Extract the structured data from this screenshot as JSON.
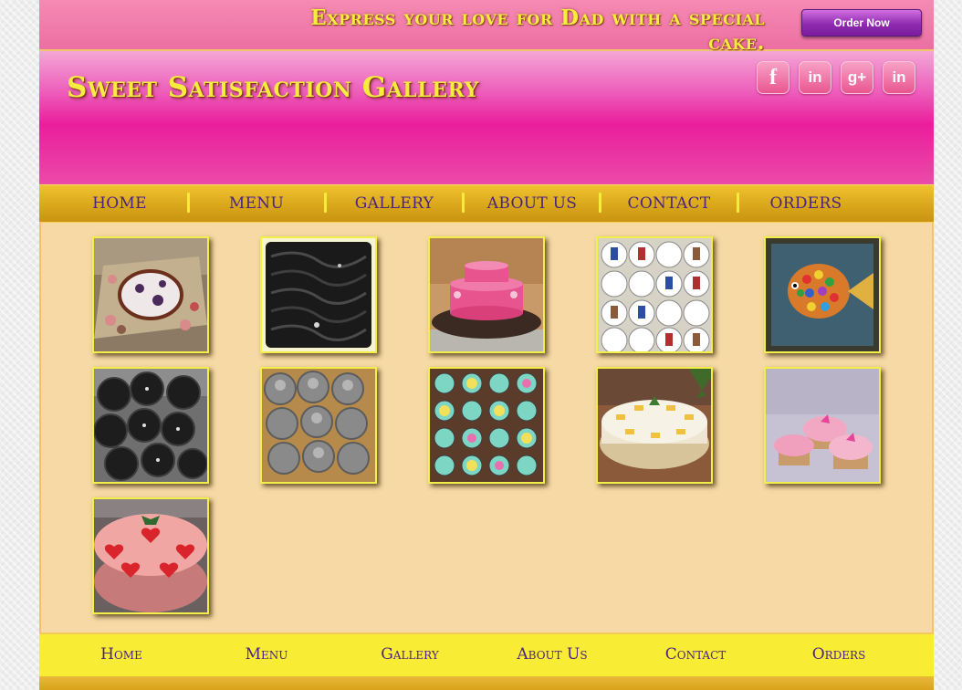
{
  "promo": {
    "text": "Express your love for Dad with a special cake.",
    "order_button": "Order Now"
  },
  "header": {
    "site_title": "Sweet Satisfaction Gallery",
    "socials": [
      {
        "icon": "facebook-icon",
        "glyph": "f"
      },
      {
        "icon": "linkedin-icon",
        "glyph": "in"
      },
      {
        "icon": "google-plus-icon",
        "glyph": "g+"
      },
      {
        "icon": "linkedin-icon",
        "glyph": "in"
      }
    ]
  },
  "nav": {
    "items": [
      "HOME",
      "MENU",
      "GALLERY",
      "ABOUT US",
      "CONTACT",
      "ORDERS"
    ]
  },
  "gallery": {
    "photos": [
      {
        "subject": "bug-shaped birthday cake on party table"
      },
      {
        "subject": "dark chocolate cake with rope-style piping"
      },
      {
        "subject": "pink two-tier cake on silver board"
      },
      {
        "subject": "father's day shirt-and-tie cupcakes"
      },
      {
        "subject": "rainbow fish cake"
      },
      {
        "subject": "dark chocolate cupcakes"
      },
      {
        "subject": "grey frosted cupcakes"
      },
      {
        "subject": "smiley face cupcakes"
      },
      {
        "subject": "pineapple cheesecake"
      },
      {
        "subject": "pink frosted cupcakes with butterflies"
      },
      {
        "subject": "strawberry cake with pink frosting"
      }
    ]
  },
  "footer_nav": {
    "items": [
      "Home",
      "Menu",
      "Gallery",
      "About Us",
      "Contact",
      "Orders"
    ]
  },
  "colors": {
    "pink": "#e91e9c",
    "gold": "#d8a519",
    "cream": "#f6d9a4",
    "yellow": "#f8ec34",
    "purple_text": "#4b2380",
    "title_yellow": "#f6ec3f"
  }
}
